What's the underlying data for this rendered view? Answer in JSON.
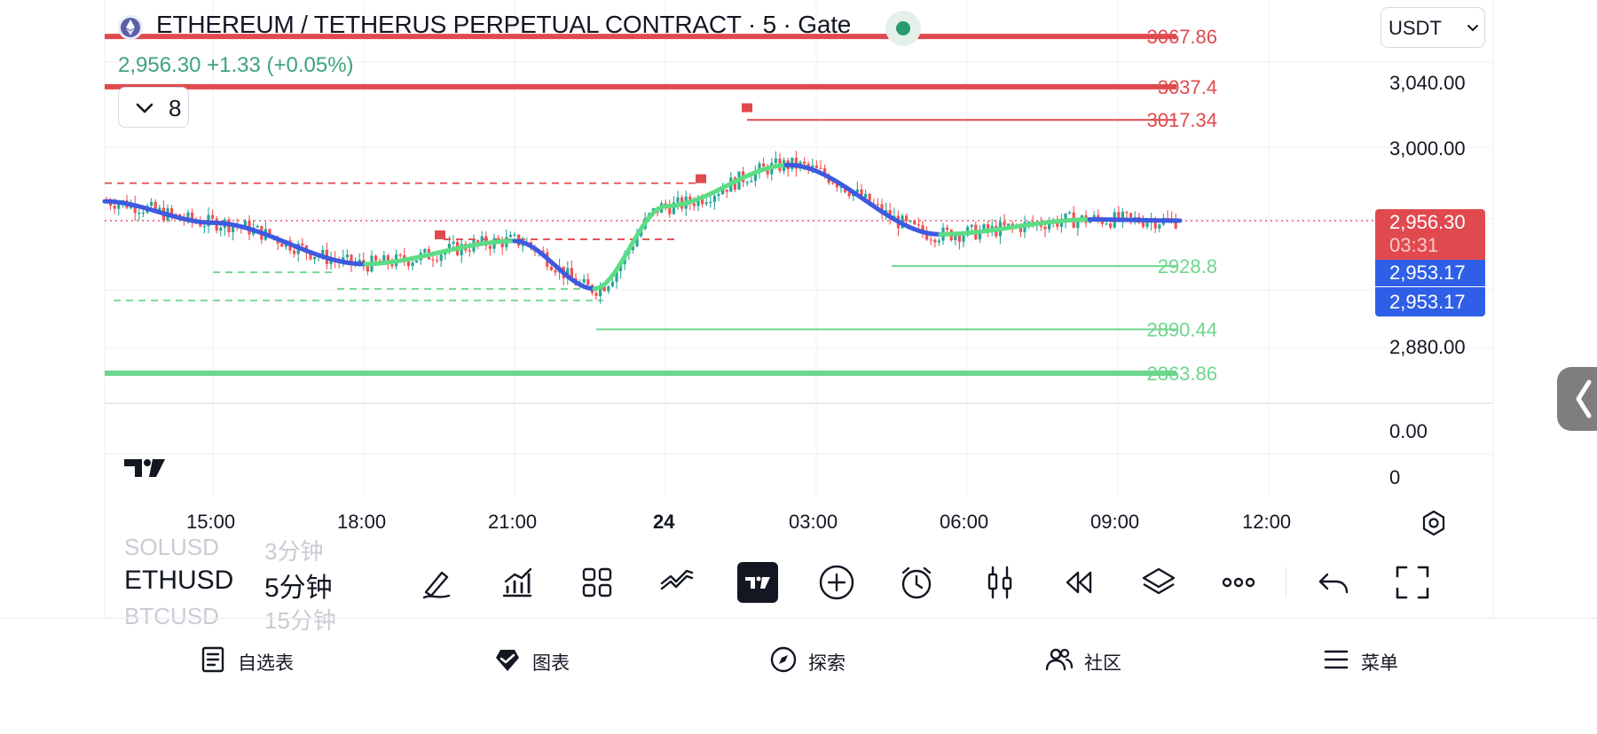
{
  "header": {
    "title": "ETHEREUM / TETHERUS PERPETUAL CONTRACT · 5 · Gate",
    "price": "2,956.30",
    "change": "+1.33 (+0.05%)",
    "indicator_count": "8",
    "currency": "USDT"
  },
  "price_axis": {
    "labels": [
      {
        "text": "3,040.00",
        "value": 3040
      },
      {
        "text": "3,000.00",
        "value": 3000
      },
      {
        "text": "2,880.00",
        "value": 2880
      }
    ],
    "volume_labels": [
      "0.00",
      "0"
    ],
    "tags": {
      "last_price": "2,956.30",
      "countdown": "03:31",
      "indicator_1": "2,953.17",
      "indicator_2": "2,953.17"
    }
  },
  "time_axis": {
    "labels": [
      "15:00",
      "18:00",
      "21:00",
      "24",
      "03:00",
      "06:00",
      "09:00",
      "12:00"
    ],
    "bold_label": "24"
  },
  "levels": [
    {
      "text": "3067.86",
      "value": 3067.86,
      "kind": "resistance"
    },
    {
      "text": "3037.4",
      "value": 3037.4,
      "kind": "resistance"
    },
    {
      "text": "3017.34",
      "value": 3017.34,
      "kind": "resistance"
    },
    {
      "text": "2928.8",
      "value": 2928.8,
      "kind": "support"
    },
    {
      "text": "2890.44",
      "value": 2890.44,
      "kind": "support"
    },
    {
      "text": "2863.86",
      "value": 2863.86,
      "kind": "support"
    }
  ],
  "chart_data": {
    "type": "line",
    "title": "ETHEREUM / TETHERUS PERPETUAL CONTRACT · 5 · Gate",
    "x": [
      "15:00",
      "18:00",
      "21:00",
      "24",
      "03:00",
      "06:00",
      "09:00"
    ],
    "series": [
      {
        "values": [
          2965,
          2934,
          2944,
          2914,
          2978,
          2950,
          2956
        ]
      }
    ],
    "ylim": [
      2850,
      3080
    ],
    "last_value": 2956.3,
    "colors": {
      "up": "#26a69a",
      "down": "#ef5350",
      "trend_up": "#5ddc85",
      "trend_down": "#3d5ae0",
      "level_red": "#e04a4f",
      "level_green": "#6dd68e"
    }
  },
  "toolbar": {
    "symbol": "ETHUSD",
    "symbol_above": "SOLUSD",
    "symbol_below": "BTCUSD",
    "interval": "5分钟",
    "interval_above": "3分钟",
    "interval_below": "15分钟",
    "buttons": [
      "draw-icon",
      "indicators-icon",
      "layout-icon",
      "compare-icon",
      "tradingview-icon",
      "add-icon",
      "alert-icon",
      "chart-type-icon",
      "replay-icon",
      "layers-icon",
      "more-icon",
      "undo-icon",
      "fullscreen-icon"
    ]
  },
  "bottom_nav": {
    "items": [
      {
        "label": "自选表",
        "icon": "watchlist-icon"
      },
      {
        "label": "图表",
        "icon": "chart-icon"
      },
      {
        "label": "探索",
        "icon": "compass-icon"
      },
      {
        "label": "社区",
        "icon": "community-icon"
      },
      {
        "label": "菜单",
        "icon": "menu-icon"
      }
    ]
  }
}
